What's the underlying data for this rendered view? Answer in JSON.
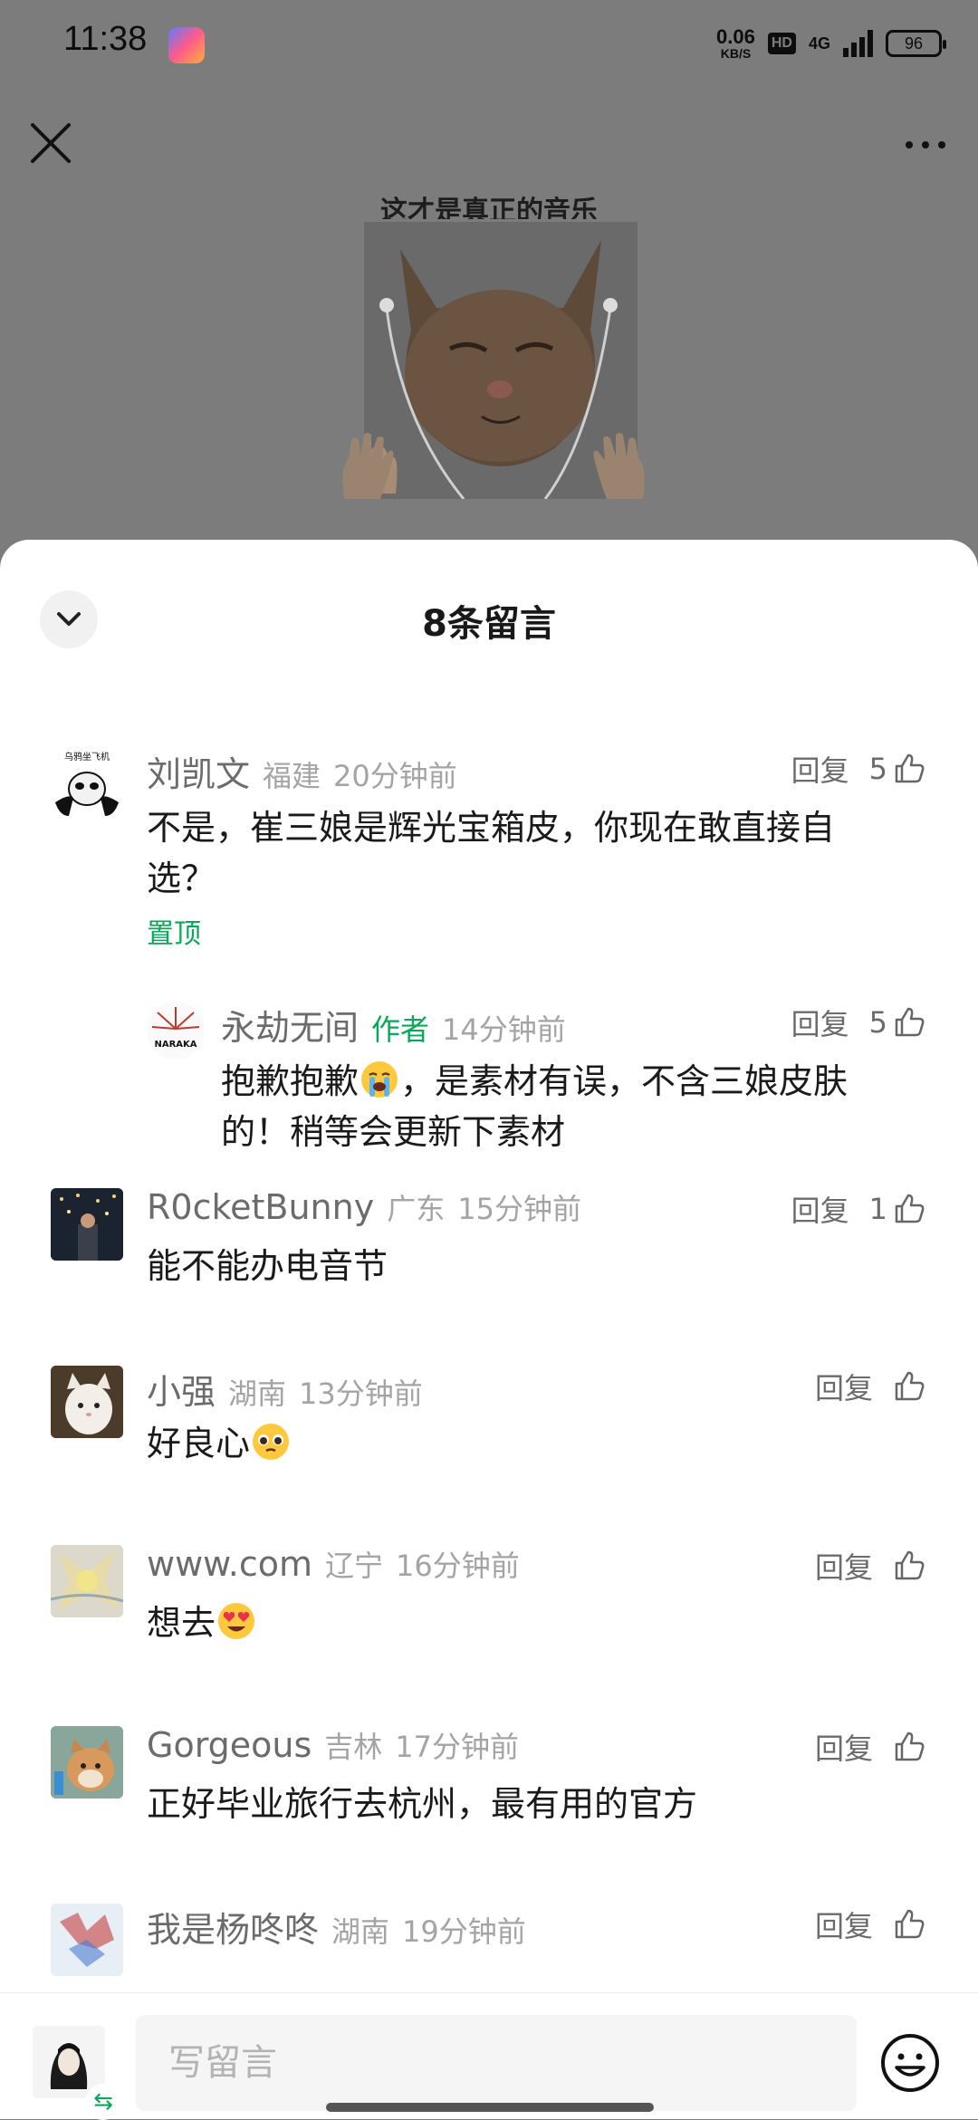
{
  "status_bar": {
    "time": "11:38",
    "net_speed_value": "0.06",
    "net_speed_unit": "KB/S",
    "hd": "HD",
    "network": "4G",
    "battery": "96"
  },
  "article": {
    "caption": "这才是真正的音乐"
  },
  "sheet": {
    "title": "8条留言"
  },
  "comments": [
    {
      "name": "刘凯文",
      "location": "福建",
      "time": "20分钟前",
      "reply_label": "回复",
      "likes": "5",
      "text": "不是，崔三娘是辉光宝箱皮，你现在敢直接自选？",
      "pinned_label": "置顶"
    },
    {
      "name": "永劫无间",
      "author_badge": "作者",
      "time": "14分钟前",
      "reply_label": "回复",
      "likes": "5",
      "text_line1_a": "抱歉抱歉",
      "text_line1_b": "，是素材有误，不含三娘皮肤",
      "text_line2": "的！稍等会更新下素材"
    },
    {
      "name": "R0cketBunny",
      "location": "广东",
      "time": "15分钟前",
      "reply_label": "回复",
      "likes": "1",
      "text": "能不能办电音节"
    },
    {
      "name": "小强",
      "location": "湖南",
      "time": "13分钟前",
      "reply_label": "回复",
      "text": "好良心"
    },
    {
      "name": "www.com",
      "location": "辽宁",
      "time": "16分钟前",
      "reply_label": "回复",
      "text": "想去"
    },
    {
      "name": "Gorgeous",
      "location": "吉林",
      "time": "17分钟前",
      "reply_label": "回复",
      "text": "正好毕业旅行去杭州，最有用的官方"
    },
    {
      "name": "我是杨咚咚",
      "location": "湖南",
      "time": "19分钟前",
      "reply_label": "回复"
    }
  ],
  "input_bar": {
    "placeholder": "写留言",
    "switch_glyph": "⇆"
  },
  "colors": {
    "accent_green": "#07a85a",
    "overlay": "#7c7c7c",
    "text_primary": "#1a1a1a",
    "text_secondary": "#6b6b6b",
    "text_meta": "#a4a4a4"
  }
}
